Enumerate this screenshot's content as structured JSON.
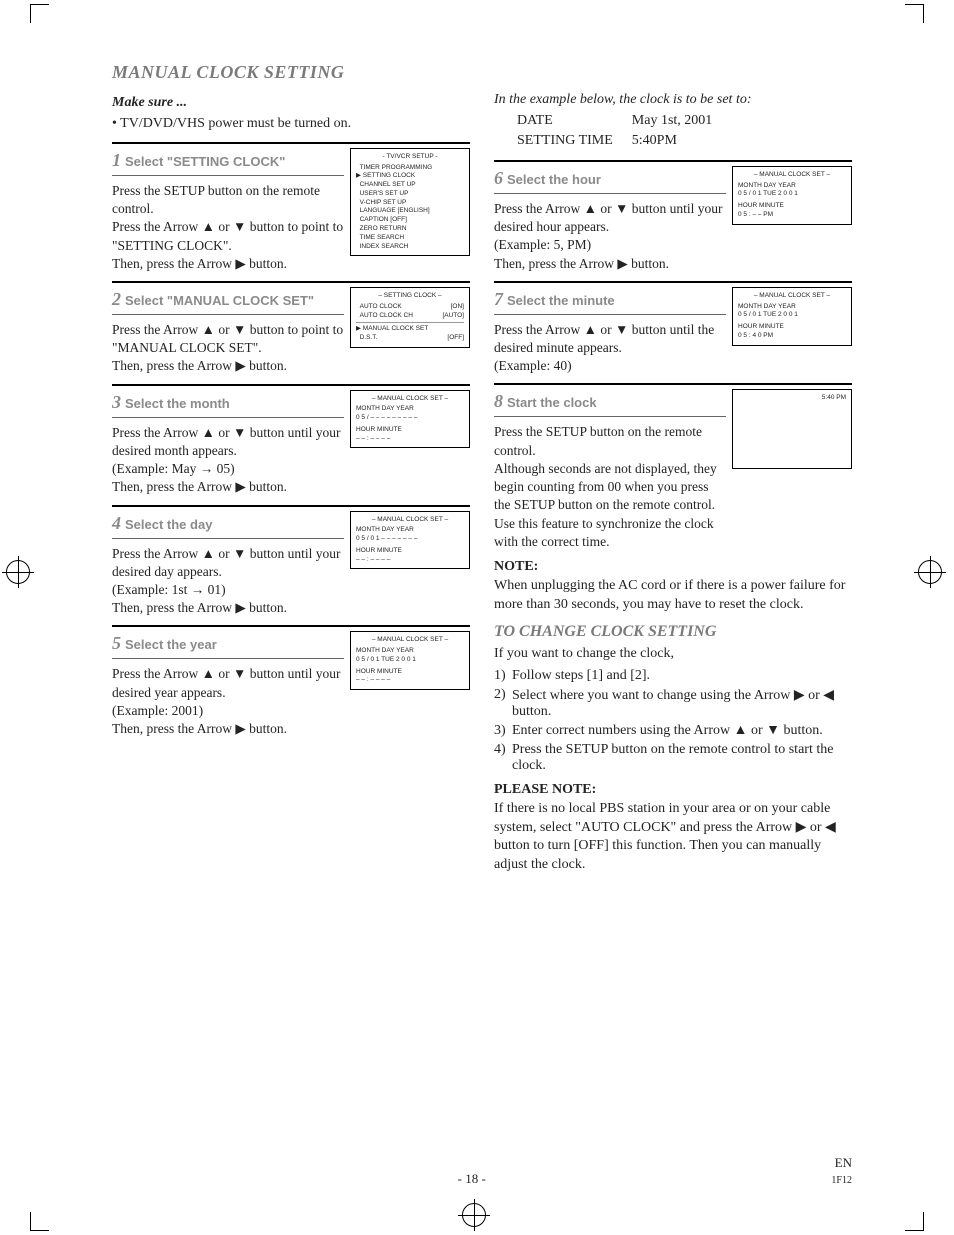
{
  "section_title": "MANUAL CLOCK SETTING",
  "make_sure_label": "Make sure ...",
  "make_sure_item": "• TV/DVD/VHS power must be turned on.",
  "example_intro": "In the example below, the clock is to be set to:",
  "example": {
    "date_label": "DATE",
    "date_val": "May 1st, 2001",
    "time_label": "SETTING TIME",
    "time_val": "5:40PM"
  },
  "icons": {
    "up": "▲",
    "down": "▼",
    "right": "▶",
    "left": "◀"
  },
  "steps": [
    {
      "n": "1",
      "title": "Select \"SETTING CLOCK\"",
      "body": "Press the SETUP button on the remote control.\nPress the Arrow ▲ or ▼ button to point to \"SETTING CLOCK\".\nThen, press the Arrow ▶ button.",
      "osd": {
        "type": "menu",
        "title": "- TV/VCR SETUP -",
        "lines": [
          "TIMER PROGRAMMING",
          "SETTING CLOCK",
          "CHANNEL SET UP",
          "USER'S SET UP",
          "V-CHIP SET UP",
          "LANGUAGE   [ENGLISH]",
          "CAPTION   [OFF]",
          "ZERO RETURN",
          "TIME SEARCH",
          "INDEX SEARCH"
        ],
        "pointer": 1
      }
    },
    {
      "n": "2",
      "title": "Select \"MANUAL CLOCK SET\"",
      "body": "Press the Arrow ▲ or ▼ button to point to \"MANUAL CLOCK SET\".\nThen, press the Arrow ▶ button.",
      "osd": {
        "type": "rows",
        "title": "– SETTING CLOCK –",
        "rows": [
          [
            "AUTO CLOCK",
            "[ON]"
          ],
          [
            "AUTO CLOCK CH",
            "[AUTO]"
          ],
          [
            "MANUAL CLOCK SET",
            ""
          ],
          [
            "D.S.T.",
            "[OFF]"
          ]
        ],
        "pointer": 2
      }
    },
    {
      "n": "3",
      "title": "Select the month",
      "body": "Press the Arrow ▲ or ▼ button until your desired month appears.\n(Example: May → 05)\nThen, press the Arrow ▶ button.",
      "osd": {
        "type": "clock",
        "title": "– MANUAL CLOCK SET –",
        "line1": "MONTH  DAY            YEAR",
        "line2": " 0 5 / – –  – – –  – – – –",
        "line3": "HOUR   MINUTE",
        "line4": "– – : – –  – –"
      }
    },
    {
      "n": "4",
      "title": "Select the day",
      "body": "Press the Arrow ▲ or ▼ button until your desired day appears.\n(Example: 1st → 01)\nThen, press the Arrow ▶ button.",
      "osd": {
        "type": "clock",
        "title": "– MANUAL CLOCK SET –",
        "line1": "MONTH  DAY            YEAR",
        "line2": " 0 5  /  0 1   – – –  – – – –",
        "line3": "HOUR   MINUTE",
        "line4": "– – : – –  – –"
      }
    },
    {
      "n": "5",
      "title": "Select the year",
      "body": "Press the Arrow ▲ or ▼ button until your desired year appears.\n(Example: 2001)\nThen, press the Arrow ▶ button.",
      "osd": {
        "type": "clock",
        "title": "– MANUAL CLOCK SET –",
        "line1": "MONTH  DAY            YEAR",
        "line2": " 0 5  /  0 1  TUE  2 0 0 1",
        "line3": "HOUR   MINUTE",
        "line4": "– – : – –  – –"
      }
    },
    {
      "n": "6",
      "title": "Select the hour",
      "body": "Press the Arrow ▲ or ▼ button until your desired hour appears.\n(Example: 5, PM)\nThen, press the Arrow ▶ button.",
      "osd": {
        "type": "clock",
        "title": "– MANUAL CLOCK SET –",
        "line1": "MONTH  DAY            YEAR",
        "line2": " 0 5  /  0 1  TUE  2 0 0 1",
        "line3": "HOUR   MINUTE",
        "line4": " 0 5 : – –  PM"
      }
    },
    {
      "n": "7",
      "title": "Select the minute",
      "body": "Press the Arrow ▲ or ▼ button until the desired minute appears.\n(Example: 40)",
      "osd": {
        "type": "clock",
        "title": "– MANUAL CLOCK SET –",
        "line1": "MONTH  DAY            YEAR",
        "line2": " 0 5  /  0 1  TUE  2 0 0 1",
        "line3": "HOUR   MINUTE",
        "line4": " 0 5 :  4 0  PM"
      }
    },
    {
      "n": "8",
      "title": "Start the clock",
      "body": "Press the SETUP button on the remote control.\nAlthough seconds are not displayed, they begin counting from 00 when you press the SETUP button on the remote control. Use this feature to synchronize the clock with the correct time.",
      "osd": {
        "type": "time",
        "text": "5:40 PM"
      }
    }
  ],
  "note_label": "NOTE:",
  "note_text": "When unplugging the AC cord or if there is a power failure for more than 30 seconds, you may have to reset the clock.",
  "change_title": "TO CHANGE CLOCK SETTING",
  "change_intro": "If you want to change the clock,",
  "change_steps": [
    "Follow steps [1] and [2].",
    "Select where you want to change using the Arrow ▶ or ◀ button.",
    "Enter correct numbers using the Arrow ▲ or ▼ button.",
    "Press the SETUP button on the remote control to start the clock."
  ],
  "please_note_label": "PLEASE NOTE:",
  "please_note_text": "If there is no local PBS station in your area or on your cable system, select \"AUTO CLOCK\" and press the Arrow ▶ or ◀ button to turn [OFF] this function. Then you can manually adjust the clock.",
  "footer": {
    "page": "- 18 -",
    "lang": "EN",
    "code": "1F12"
  }
}
